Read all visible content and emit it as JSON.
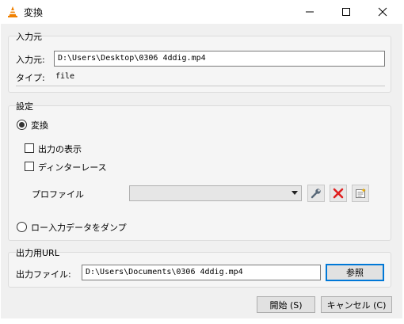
{
  "window": {
    "title": "変換",
    "minimize_glyph": "—",
    "maximize_glyph": "☐",
    "close_glyph": "✕"
  },
  "source": {
    "group_title": "入力元",
    "input_label": "入力元:",
    "input_value": "D:\\Users\\Desktop\\0306 4ddig.mp4",
    "type_label": "タイプ:",
    "type_value": "file"
  },
  "settings": {
    "group_title": "設定",
    "convert_label": "変換",
    "show_output_label": "出力の表示",
    "deinterlace_label": "ディンターレース",
    "profile_label": "プロファイル",
    "profile_value": "",
    "dump_label": "ロー入力データをダンプ"
  },
  "destination": {
    "group_title": "出力用URL",
    "file_label": "出力ファイル:",
    "file_value": "D:\\Users\\Documents\\0306 4ddig.mp4",
    "browse_label": "参照"
  },
  "actions": {
    "start_label": "開始 (S)",
    "cancel_label": "キャンセル (C)"
  },
  "icons": {
    "app": "vlc-cone-icon",
    "wrench": "wrench-icon",
    "delete": "red-x-icon",
    "new_profile": "new-profile-icon"
  },
  "colors": {
    "accent": "#0078d7",
    "delete_red": "#e02020",
    "vlc_orange": "#f08000"
  }
}
